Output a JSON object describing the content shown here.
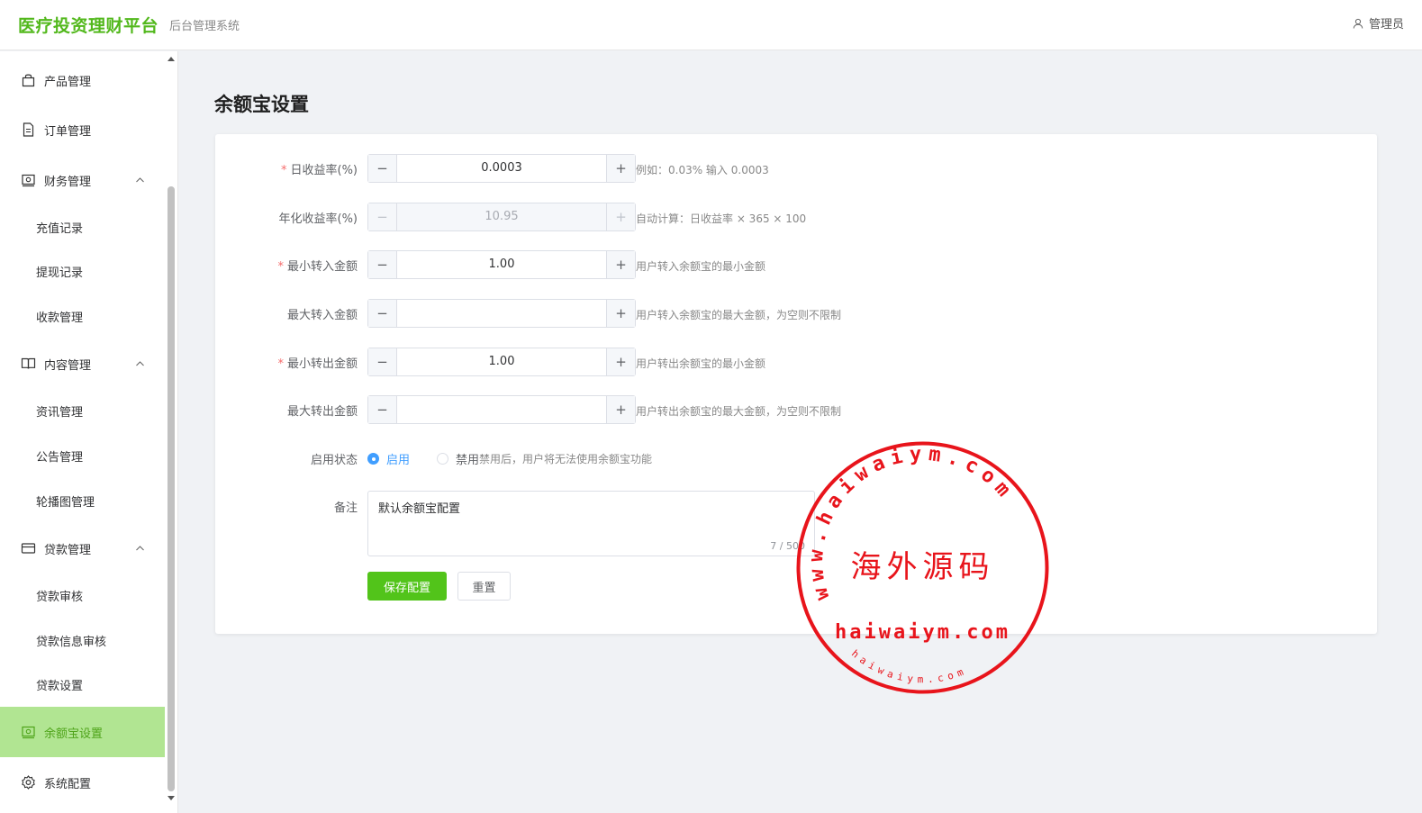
{
  "header": {
    "brand": "医疗投资理财平台",
    "subtitle": "后台管理系统",
    "user": "管理员"
  },
  "sidebar": {
    "items": [
      {
        "label": "产品管理",
        "icon": "bag-icon"
      },
      {
        "label": "订单管理",
        "icon": "document-icon"
      },
      {
        "label": "财务管理",
        "icon": "wallet-icon",
        "expanded": true
      },
      {
        "label": "充值记录"
      },
      {
        "label": "提现记录"
      },
      {
        "label": "收款管理"
      },
      {
        "label": "内容管理",
        "icon": "book-icon",
        "expanded": true
      },
      {
        "label": "资讯管理"
      },
      {
        "label": "公告管理"
      },
      {
        "label": "轮播图管理"
      },
      {
        "label": "贷款管理",
        "icon": "card-icon",
        "expanded": true
      },
      {
        "label": "贷款审核"
      },
      {
        "label": "贷款信息审核"
      },
      {
        "label": "贷款设置"
      },
      {
        "label": "余额宝设置",
        "icon": "wallet-icon",
        "active": true
      },
      {
        "label": "系统配置",
        "icon": "gear-icon"
      }
    ]
  },
  "main": {
    "title": "余额宝设置",
    "fields": [
      {
        "label": "日收益率(%)",
        "required": true,
        "value": "0.0003",
        "hint": "例如：0.03% 输入 0.0003"
      },
      {
        "label": "年化收益率(%)",
        "required": false,
        "value": "10.95",
        "hint": "自动计算：日收益率 × 365 × 100",
        "disabled": true
      },
      {
        "label": "最小转入金额",
        "required": true,
        "value": "1.00",
        "hint": "用户转入余额宝的最小金额"
      },
      {
        "label": "最大转入金额",
        "required": false,
        "value": "",
        "hint": "用户转入余额宝的最大金额，为空则不限制"
      },
      {
        "label": "最小转出金额",
        "required": true,
        "value": "1.00",
        "hint": "用户转出余额宝的最小金额"
      },
      {
        "label": "最大转出金额",
        "required": false,
        "value": "",
        "hint": "用户转出余额宝的最大金额，为空则不限制"
      }
    ],
    "status": {
      "label": "启用状态",
      "options": [
        "启用",
        "禁用"
      ],
      "selected": "启用",
      "hint": "禁用后，用户将无法使用余额宝功能"
    },
    "remark": {
      "label": "备注",
      "value": "默认余额宝配置",
      "count": "7 / 500"
    },
    "save_label": "保存配置",
    "reset_label": "重置"
  },
  "watermark": {
    "arc_text": "www.haiwaiym.com",
    "center_text": "海外源码",
    "domain_text": "haiwaiym.com",
    "bottom_text": "haiwaiym.com",
    "color": "#e8141b"
  }
}
